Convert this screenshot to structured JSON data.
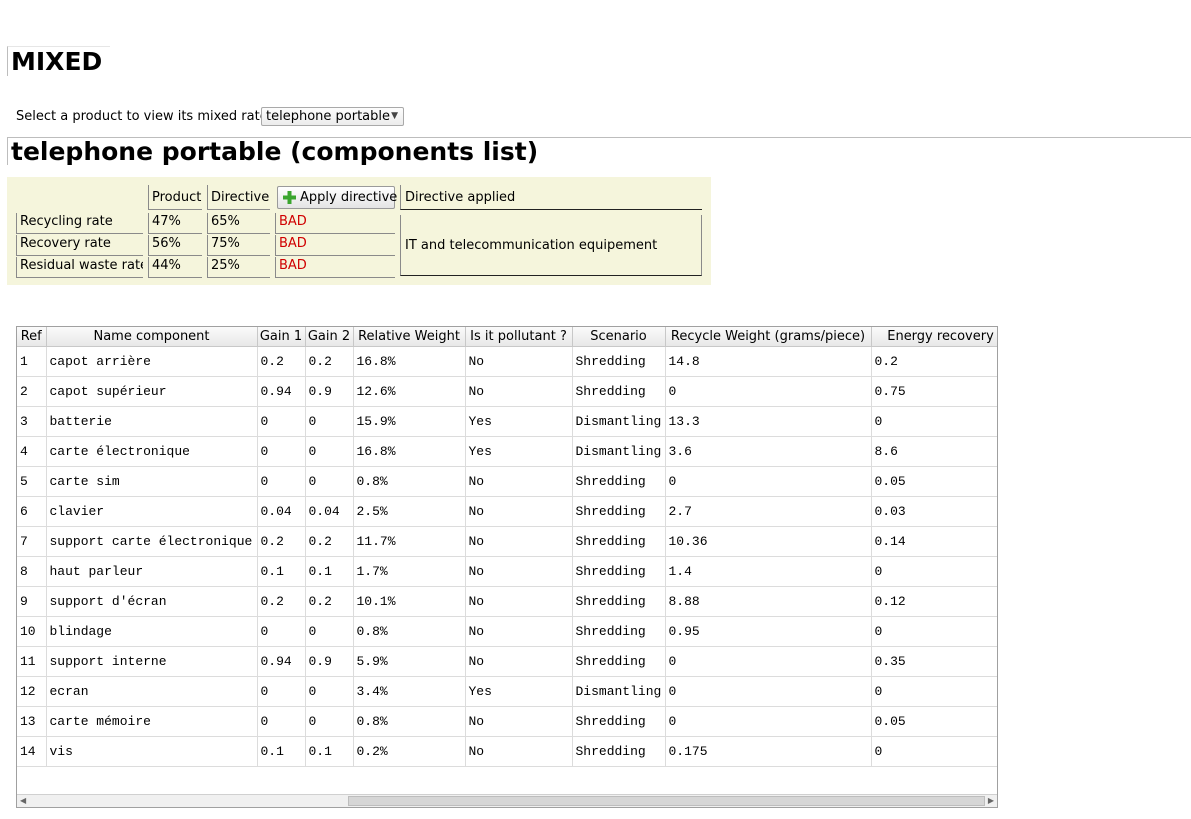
{
  "page": {
    "title": "MIXED"
  },
  "selector": {
    "prompt": "Select a product to view its mixed rates",
    "selected": "telephone portable"
  },
  "components_title": "telephone portable (components list)",
  "rates": {
    "col_product": "Product",
    "col_directive": "Directive",
    "apply_label": "Apply directive",
    "directive_applied_label": "Directive applied",
    "directive_category": "IT and telecommunication equipement",
    "rows": [
      {
        "label": "Recycling rate",
        "product": "47%",
        "directive": "65%",
        "status": "BAD"
      },
      {
        "label": "Recovery rate",
        "product": "56%",
        "directive": "75%",
        "status": "BAD"
      },
      {
        "label": "Residual waste rate",
        "product": "44%",
        "directive": "25%",
        "status": "BAD"
      }
    ],
    "status_color": "#d00000",
    "panel_color": "#f5f5dc"
  },
  "table": {
    "headers": [
      "Ref",
      "Name component",
      "Gain 1",
      "Gain 2",
      "Relative Weight",
      "Is it pollutant ?",
      "Scenario",
      "Recycle Weight (grams/piece)",
      "Energy recovery W"
    ],
    "rows": [
      [
        "1",
        "capot arrière",
        "0.2",
        "0.2",
        "16.8%",
        "No",
        "Shredding",
        "14.8",
        "0.2"
      ],
      [
        "2",
        "capot supérieur",
        "0.94",
        "0.9",
        "12.6%",
        "No",
        "Shredding",
        "0",
        "0.75"
      ],
      [
        "3",
        "batterie",
        "0",
        "0",
        "15.9%",
        "Yes",
        "Dismantling",
        "13.3",
        "0"
      ],
      [
        "4",
        "carte électronique",
        "0",
        "0",
        "16.8%",
        "Yes",
        "Dismantling",
        "3.6",
        "8.6"
      ],
      [
        "5",
        "carte sim",
        "0",
        "0",
        "0.8%",
        "No",
        "Shredding",
        "0",
        "0.05"
      ],
      [
        "6",
        "clavier",
        "0.04",
        "0.04",
        "2.5%",
        "No",
        "Shredding",
        "2.7",
        "0.03"
      ],
      [
        "7",
        "support carte électronique",
        "0.2",
        "0.2",
        "11.7%",
        "No",
        "Shredding",
        "10.36",
        "0.14"
      ],
      [
        "8",
        "haut parleur",
        "0.1",
        "0.1",
        "1.7%",
        "No",
        "Shredding",
        "1.4",
        "0"
      ],
      [
        "9",
        "support d'écran",
        "0.2",
        "0.2",
        "10.1%",
        "No",
        "Shredding",
        "8.88",
        "0.12"
      ],
      [
        "10",
        "blindage",
        "0",
        "0",
        "0.8%",
        "No",
        "Shredding",
        "0.95",
        "0"
      ],
      [
        "11",
        "support interne",
        "0.94",
        "0.9",
        "5.9%",
        "No",
        "Shredding",
        "0",
        "0.35"
      ],
      [
        "12",
        "ecran",
        "0",
        "0",
        "3.4%",
        "Yes",
        "Dismantling",
        "0",
        "0"
      ],
      [
        "13",
        "carte mémoire",
        "0",
        "0",
        "0.8%",
        "No",
        "Shredding",
        "0",
        "0.05"
      ],
      [
        "14",
        "vis",
        "0.1",
        "0.1",
        "0.2%",
        "No",
        "Shredding",
        "0.175",
        "0"
      ]
    ]
  },
  "icons": {
    "apply": "plus-icon",
    "select": "chevron-down-icon",
    "scroll_left": "arrow-left-icon",
    "scroll_right": "arrow-right-icon"
  }
}
